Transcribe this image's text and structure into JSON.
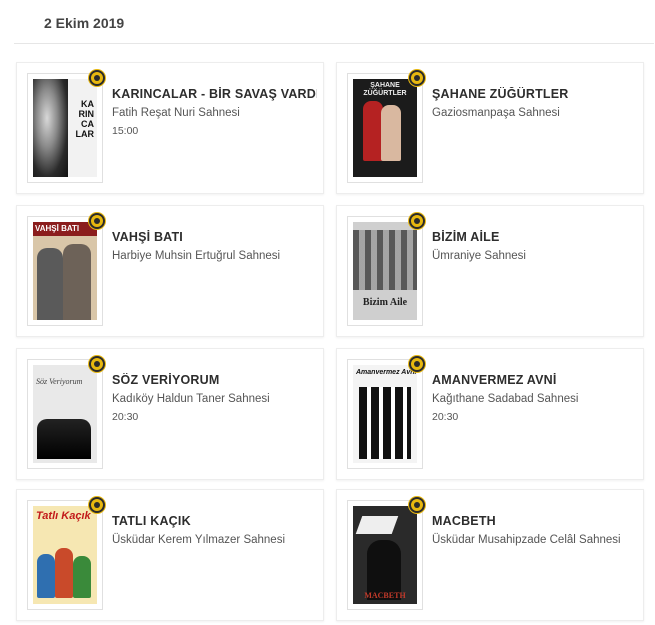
{
  "date": "2 Ekim 2019",
  "events": [
    {
      "title": "KARINCALAR - BİR SAVAŞ VARDI",
      "venue": "Fatih Reşat Nuri Sahnesi",
      "time": "15:00",
      "poster_text": "KA\nRIN\nCA\nLAR"
    },
    {
      "title": "ŞAHANE ZÜĞÜRTLER",
      "venue": "Gaziosmanpaşa Sahnesi",
      "time": "",
      "poster_text": "ŞAHANE ZÜĞÜRTLER"
    },
    {
      "title": "VAHŞİ BATI",
      "venue": "Harbiye Muhsin Ertuğrul Sahnesi",
      "time": "",
      "poster_text": "VAHŞİ BATI"
    },
    {
      "title": "BİZİM AİLE",
      "venue": "Ümraniye Sahnesi",
      "time": "",
      "poster_text": "Bizim Aile"
    },
    {
      "title": "SÖZ VERİYORUM",
      "venue": "Kadıköy Haldun Taner Sahnesi",
      "time": "20:30",
      "poster_text": "Söz Veriyorum"
    },
    {
      "title": "AMANVERMEZ AVNİ",
      "venue": "Kağıthane Sadabad Sahnesi",
      "time": "20:30",
      "poster_text": "Amanvermez Avni"
    },
    {
      "title": "TATLI KAÇIK",
      "venue": "Üsküdar Kerem Yılmazer Sahnesi",
      "time": "",
      "poster_text": "Tatlı Kaçık"
    },
    {
      "title": "MACBETH",
      "venue": "Üsküdar Musahipzade Celâl Sahnesi",
      "time": "",
      "poster_text": "MACBETH"
    }
  ],
  "colors": {
    "seal": "#e8b80f",
    "card_border": "#ededed",
    "title": "#2d2d2d",
    "venue": "#555555"
  }
}
